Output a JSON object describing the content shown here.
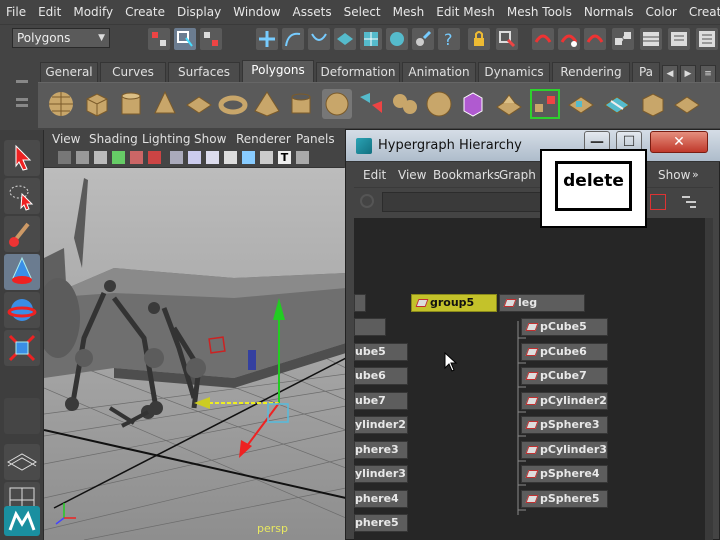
{
  "menubar": {
    "items": [
      "File",
      "Edit",
      "Modify",
      "Create",
      "Display",
      "Window",
      "Assets",
      "Select",
      "Mesh",
      "Edit Mesh",
      "Mesh Tools",
      "Normals",
      "Color",
      "Create UVs"
    ]
  },
  "status_line": {
    "mode_selector": "Polygons"
  },
  "shelf": {
    "tabs": [
      "General",
      "Curves",
      "Surfaces",
      "Polygons",
      "Deformation",
      "Animation",
      "Dynamics",
      "Rendering",
      "Pa"
    ],
    "active_tab": "Polygons"
  },
  "viewport": {
    "menu": [
      "View",
      "Shading",
      "Lighting",
      "Show",
      "Renderer",
      "Panels"
    ],
    "camera_label": "persp"
  },
  "hypergraph": {
    "title": "Hypergraph Hierarchy",
    "menu": [
      "Edit",
      "View",
      "Bookmarks",
      "Graph",
      "Show"
    ],
    "window_buttons": {
      "close": "✕"
    },
    "nodes": {
      "group5": "group5",
      "leg": "leg",
      "leg_children": [
        "pCube5",
        "pCube6",
        "pCube7",
        "pCylinder2",
        "pSphere3",
        "pCylinder3",
        "pSphere4",
        "pSphere5"
      ],
      "left_partial": [
        "",
        "",
        "ube5",
        "ube6",
        "ube7",
        "ylinder2",
        "phere3",
        "ylinder3",
        "phere4",
        "phere5"
      ]
    }
  },
  "overlay": {
    "key_label": "delete"
  },
  "colors": {
    "selected_node": "#c4c22a",
    "node": "#5d5d5d",
    "graph_bg": "#262626",
    "close_button": "#c0392b"
  }
}
